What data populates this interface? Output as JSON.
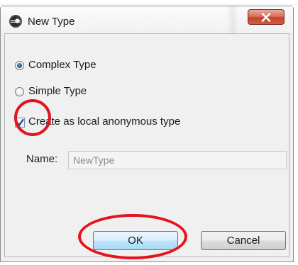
{
  "window": {
    "title": "New Type",
    "icon": "eclipse-app-icon",
    "close_icon": "close-icon",
    "close_color": "#c7432c"
  },
  "options": {
    "complex_type_label": "Complex Type",
    "complex_type_selected": true,
    "simple_type_label": "Simple Type",
    "simple_type_selected": false,
    "local_anonymous_label": "Create as local anonymous type",
    "local_anonymous_checked": true
  },
  "name_field": {
    "label": "Name:",
    "value": "NewType",
    "enabled": false
  },
  "buttons": {
    "ok_label": "OK",
    "cancel_label": "Cancel"
  },
  "annotations": {
    "color": "#e3141e",
    "circled": [
      "local_anonymous_checkbox",
      "ok_button"
    ]
  }
}
